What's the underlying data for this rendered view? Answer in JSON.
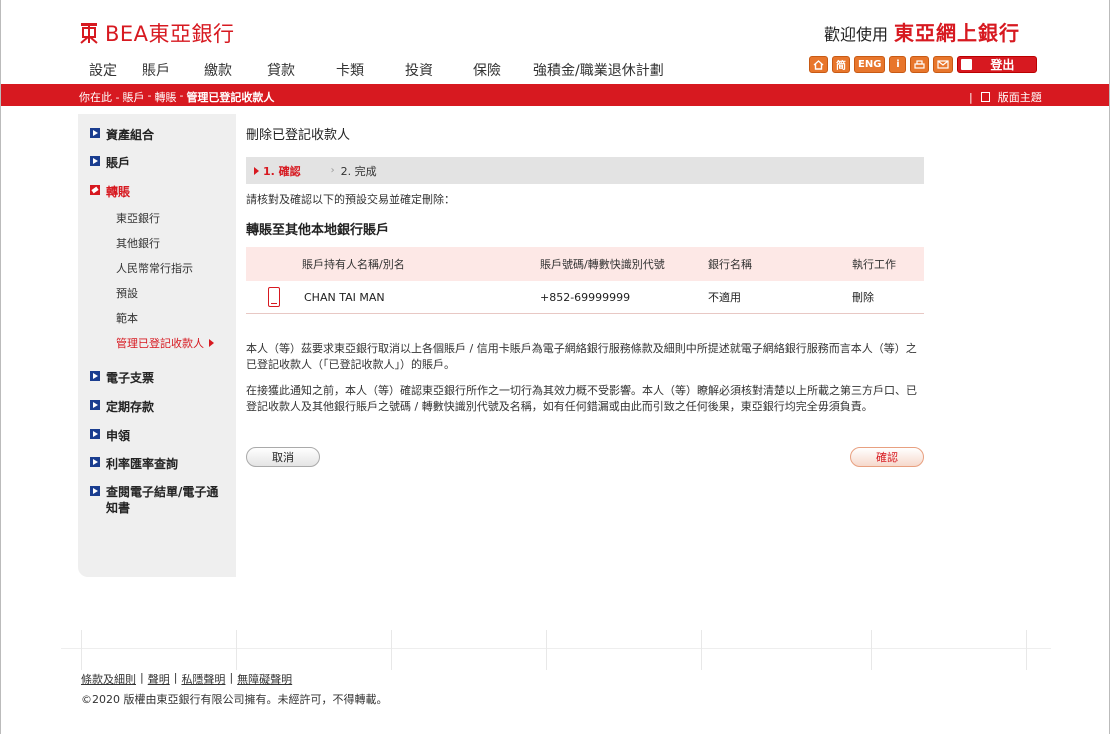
{
  "header": {
    "logo_text": "BEA東亞銀行",
    "welcome_small": "歡迎使用",
    "welcome_big": "東亞網上銀行"
  },
  "topnav": [
    "設定",
    "賬戶",
    "繳款",
    "貸款",
    "卡類",
    "投資",
    "保險",
    "強積金/職業退休計劃"
  ],
  "toolicons": {
    "home_icon": "home-icon",
    "simplified": "简",
    "english": "ENG",
    "info": "i",
    "print_icon": "print-icon",
    "mail_icon": "mail-icon",
    "logout_label": "登出"
  },
  "breadcrumb": {
    "prefix": "你在此 -",
    "items": [
      "賬戶",
      "-",
      "轉賬",
      "-",
      "管理已登記收款人"
    ],
    "theme_label": "版面主題"
  },
  "sidebar": {
    "items": [
      {
        "label": "資產組合"
      },
      {
        "label": "賬戶"
      },
      {
        "label": "轉賬"
      },
      {
        "label": "電子支票"
      },
      {
        "label": "定期存款"
      },
      {
        "label": "申領"
      },
      {
        "label": "利率匯率查詢"
      },
      {
        "label": "查閱電子結單/電子通知書"
      }
    ],
    "sub_items": [
      "東亞銀行",
      "其他銀行",
      "人民幣常行指示",
      "預設",
      "範本",
      "管理已登記收款人"
    ]
  },
  "main": {
    "title": "刪除已登記收款人",
    "step1": "1. 確認",
    "step2": "2. 完成",
    "instruction": "請核對及確認以下的預設交易並確定刪除：",
    "section_title": "轉賬至其他本地銀行賬戶",
    "table": {
      "headers": [
        "賬戶持有人名稱/別名",
        "賬戶號碼/轉數快識別代號",
        "銀行名稱",
        "執行工作"
      ],
      "rows": [
        [
          "CHAN TAI MAN",
          "+852-69999999",
          "不適用",
          "刪除"
        ]
      ]
    },
    "para1": "本人（等）茲要求東亞銀行取消以上各個賬戶 / 信用卡賬戶為電子網絡銀行服務條款及細則中所提述就電子網絡銀行服務而言本人（等）之已登記收款人（「已登記收款人」）的賬戶。",
    "para2": "在接獲此通知之前，本人（等）確認東亞銀行所作之一切行為其效力概不受影響。本人（等）瞭解必須核對清楚以上所載之第三方戶口、已登記收款人及其他銀行賬戶之號碼 / 轉數快識別代號及名稱，如有任何錯漏或由此而引致之任何後果，東亞銀行均完全毋須負責。",
    "cancel_label": "取消",
    "confirm_label": "確認"
  },
  "footer": {
    "links": [
      "條款及細則",
      "聲明",
      "私隱聲明",
      "無障礙聲明"
    ],
    "copyright": "©2020 版權由東亞銀行有限公司擁有。未經許可，不得轉載。"
  },
  "colors": {
    "brand_red": "#d71920",
    "nav_blue": "#1a3d8f",
    "icon_orange": "#e8762c"
  }
}
